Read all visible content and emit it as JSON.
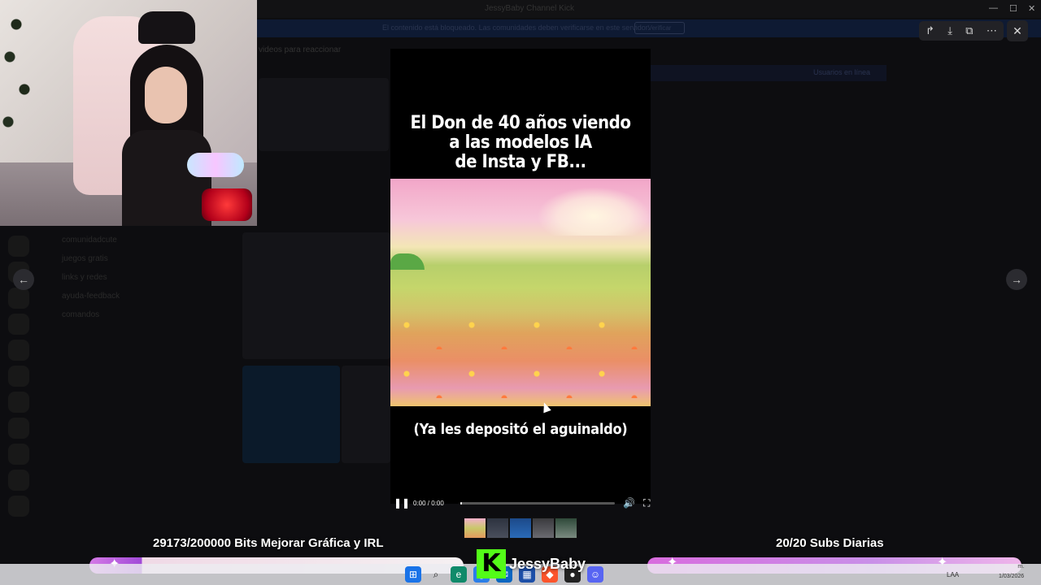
{
  "background_app": {
    "window_title": "JessyBaby Channel Kick",
    "banner_text": "El contenido está bloqueado. Las comunidades deben verificarse en este servidor.",
    "banner_button": "Verificar",
    "channel_title": "videos para reaccionar",
    "left_channels": [
      "comunidadcute",
      "juegos gratis",
      "links y redes",
      "ayuda-feedback",
      "comandos"
    ],
    "right_header": "Usuarios en línea"
  },
  "viewer": {
    "top_controls": [
      {
        "name": "share-icon",
        "glyph": "↱"
      },
      {
        "name": "download-icon",
        "glyph": "⤓"
      },
      {
        "name": "open-external-icon",
        "glyph": "⧉"
      },
      {
        "name": "more-icon",
        "glyph": "⋯"
      }
    ],
    "close_glyph": "✕",
    "prev_glyph": "←",
    "next_glyph": "→"
  },
  "meme": {
    "title_line1": "El Don de 40 años viendo",
    "title_line2": "a las modelos IA",
    "title_line3": "de Insta y FB...",
    "caption": "(Ya les depositó el aguinaldo)"
  },
  "player": {
    "play_glyph": "❚❚",
    "time": "0:00 / 0:00",
    "progress": 0.01,
    "volume_glyph": "🔊",
    "fullscreen_glyph": "⛶"
  },
  "overlay": {
    "goal_left": "29173/200000 Bits Mejorar Gráfica y IRL",
    "goal_right": "20/20 Subs Diarias",
    "kick_letter": "K",
    "streamer_name": "JessyBaby",
    "colors": {
      "kick_green": "#53fc18",
      "pink": "#e07ae6"
    }
  },
  "taskbar": {
    "icons": [
      "windows-icon",
      "search-icon",
      "edge-icon",
      "chrome-icon",
      "outlook-icon",
      "store-icon",
      "brave-icon",
      "obs-icon",
      "discord-icon"
    ],
    "tray_lang": "LAA",
    "clock_time": "m.",
    "clock_date": "1/03/2026"
  }
}
